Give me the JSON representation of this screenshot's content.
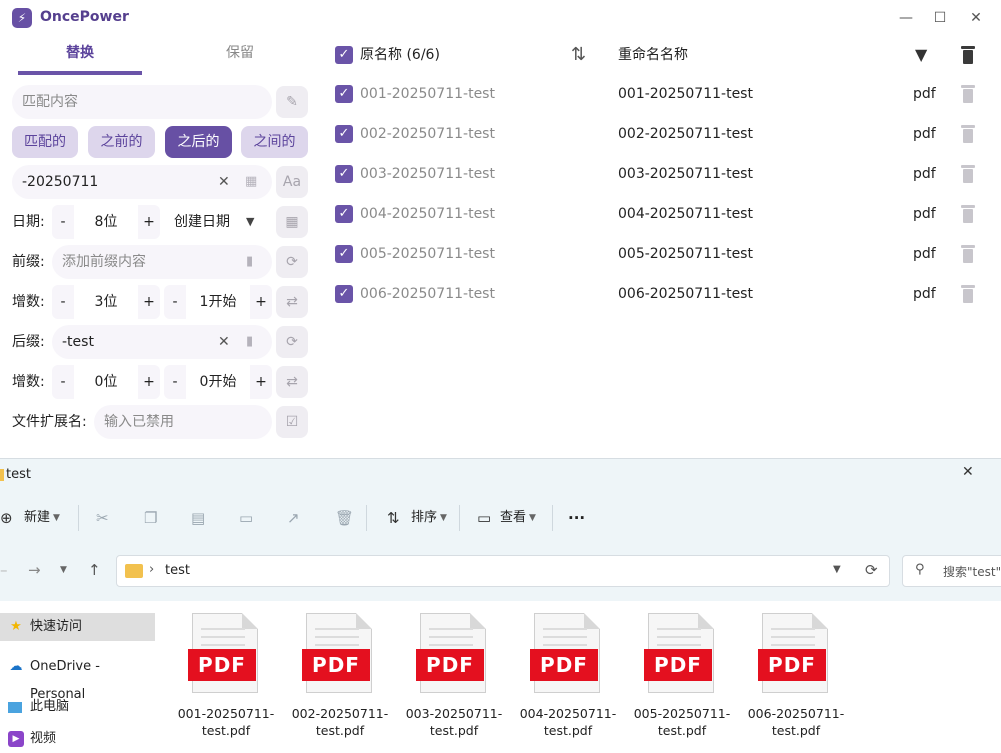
{
  "app": {
    "title": "OncePower",
    "window_controls": {
      "minimize": "—",
      "maximize": "☐",
      "close": "✕"
    },
    "tabs": [
      {
        "label": "替换"
      },
      {
        "label": "保留"
      }
    ],
    "match": {
      "placeholder": "匹配内容"
    },
    "modes": [
      {
        "label": "匹配的"
      },
      {
        "label": "之前的"
      },
      {
        "label": "之后的"
      },
      {
        "label": "之间的"
      }
    ],
    "selected_mode": "之后的",
    "replace": {
      "value": "-20250711"
    },
    "date": {
      "label": "日期:",
      "minus": "-",
      "plus": "+",
      "value": "8位",
      "type": "创建日期"
    },
    "prefix": {
      "label": "前缀:",
      "placeholder": "添加前缀内容"
    },
    "increment1": {
      "label": "增数:",
      "digits": "3位",
      "start": "1开始",
      "minus": "-",
      "plus": "+"
    },
    "suffix": {
      "label": "后缀:",
      "value": "-test"
    },
    "increment2": {
      "label": "增数:",
      "digits": "0位",
      "start": "0开始",
      "minus": "-",
      "plus": "+"
    },
    "extension": {
      "label": "文件扩展名:",
      "placeholder": "输入已禁用"
    },
    "list": {
      "header_original": "原名称 (6/6)",
      "header_rename": "重命名名称",
      "rows": [
        {
          "original": "001-20250711-test",
          "renamed": "001-20250711-test",
          "ext": "pdf"
        },
        {
          "original": "002-20250711-test",
          "renamed": "002-20250711-test",
          "ext": "pdf"
        },
        {
          "original": "003-20250711-test",
          "renamed": "003-20250711-test",
          "ext": "pdf"
        },
        {
          "original": "004-20250711-test",
          "renamed": "004-20250711-test",
          "ext": "pdf"
        },
        {
          "original": "005-20250711-test",
          "renamed": "005-20250711-test",
          "ext": "pdf"
        },
        {
          "original": "006-20250711-test",
          "renamed": "006-20250711-test",
          "ext": "pdf"
        }
      ]
    },
    "colors": {
      "accent": "#6750a4",
      "chip": "#ddd6ec",
      "pdf_red": "#e4101f"
    }
  },
  "explorer": {
    "title": "test",
    "close": "✕",
    "toolbar": {
      "new": "新建",
      "sort": "排序",
      "view": "查看",
      "more": "···"
    },
    "address": {
      "folder": "test"
    },
    "search": {
      "placeholder": "搜索\"test\""
    },
    "nav": [
      {
        "label": "快速访问"
      },
      {
        "label": "OneDrive - Personal"
      },
      {
        "label": "此电脑"
      },
      {
        "label": "视频"
      }
    ],
    "files": [
      {
        "name": "001-20250711-test.pdf",
        "badge": "PDF"
      },
      {
        "name": "002-20250711-test.pdf",
        "badge": "PDF"
      },
      {
        "name": "003-20250711-test.pdf",
        "badge": "PDF"
      },
      {
        "name": "004-20250711-test.pdf",
        "badge": "PDF"
      },
      {
        "name": "005-20250711-test.pdf",
        "badge": "PDF"
      },
      {
        "name": "006-20250711-test.pdf",
        "badge": "PDF"
      }
    ]
  }
}
